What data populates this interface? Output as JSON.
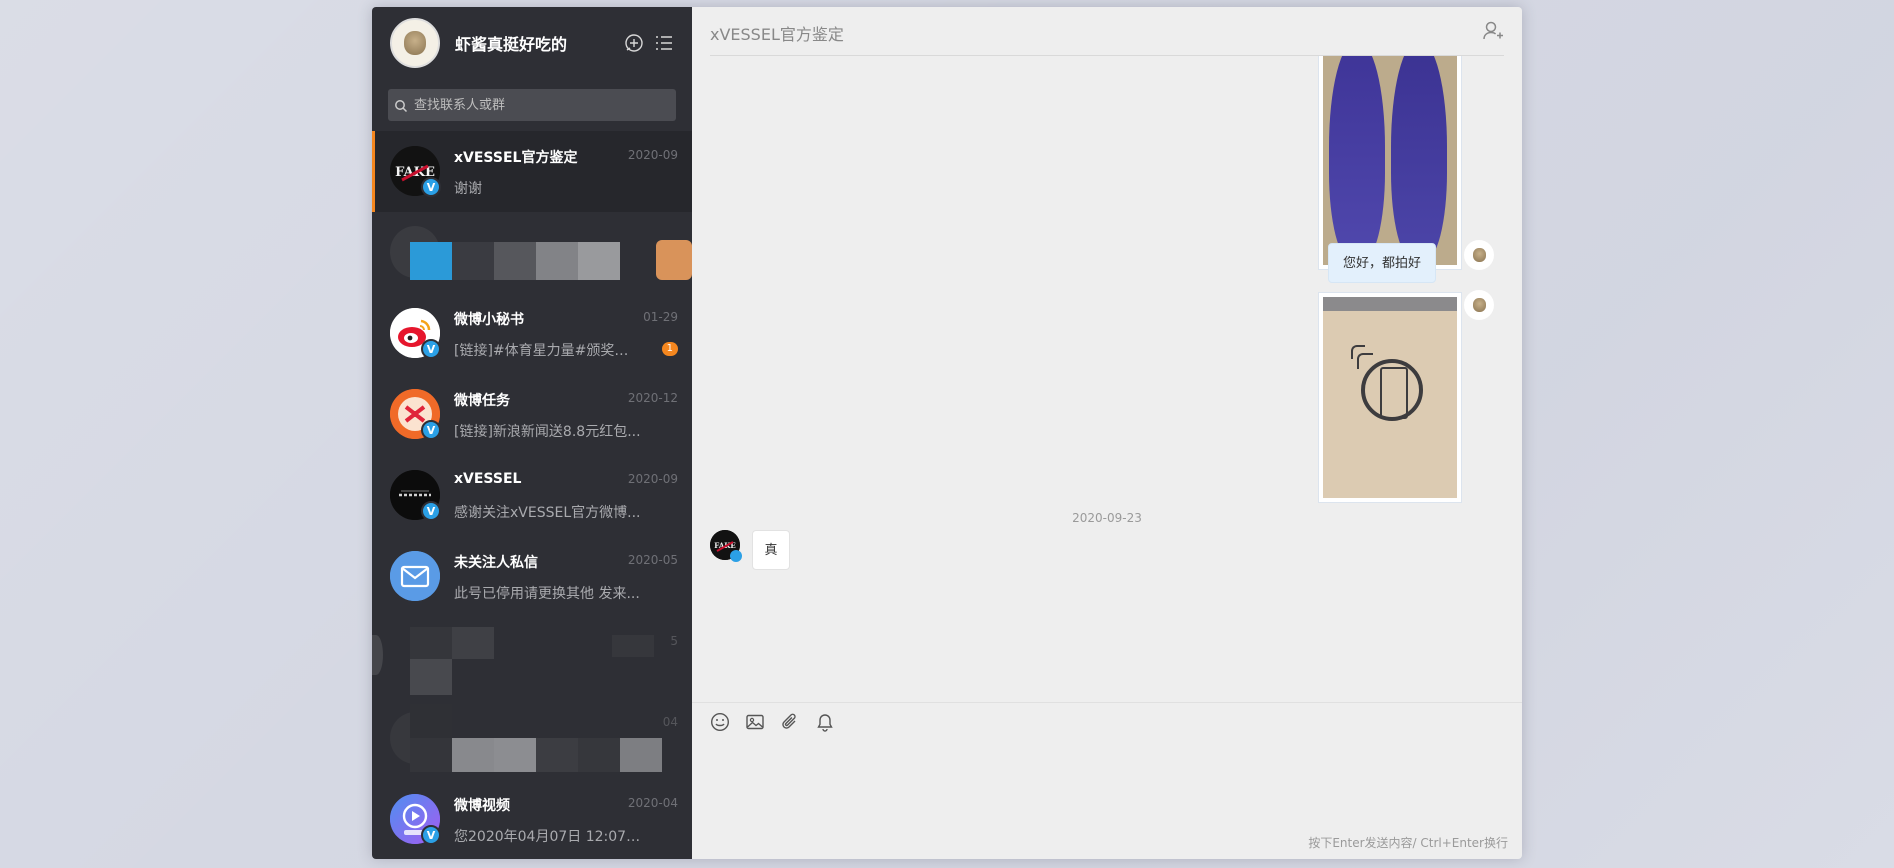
{
  "user": {
    "name": "虾酱真挺好吃的"
  },
  "search": {
    "placeholder": "查找联系人或群"
  },
  "conversations": [
    {
      "name": "xVESSEL官方鉴定",
      "date": "2020-09",
      "preview": "谢谢",
      "avatar": "fake-logo",
      "verified": true,
      "active": true
    },
    {
      "name": "微博小秘书",
      "date": "01-29",
      "preview": "[链接]#体育星力量#颁奖盛...",
      "avatar": "weibo-logo",
      "verified": true,
      "unread": "1"
    },
    {
      "name": "微博任务",
      "date": "2020-12",
      "preview": "[链接]新浪新闻送8.8元红包...",
      "avatar": "weibo-task-logo",
      "verified": true
    },
    {
      "name": "xVESSEL",
      "date": "2020-09",
      "preview": "感谢关注xVESSEL官方微博...",
      "avatar": "xvessel-logo",
      "verified": true
    },
    {
      "name": "未关注人私信",
      "date": "2020-05",
      "preview": "此号已停用请更换其他 发来...",
      "avatar": "mail-icon",
      "verified": false
    },
    {
      "name": "微博视频",
      "date": "2020-04",
      "preview": "您2020年04月07日 12:07上...",
      "avatar": "video-logo",
      "verified": true
    }
  ],
  "blurred_dates": [
    "5",
    "04"
  ],
  "chat": {
    "title": "xVESSEL官方鉴定",
    "messages": [
      {
        "type": "image",
        "side": "out",
        "content": "insole-photo"
      },
      {
        "type": "text",
        "side": "out",
        "text": "您好，都拍好了"
      },
      {
        "type": "image",
        "side": "out",
        "content": "box-stamp-photo"
      },
      {
        "type": "date",
        "text": "2020-09-23"
      },
      {
        "type": "text",
        "side": "in",
        "text": "真"
      }
    ]
  },
  "composer": {
    "tools": [
      "emoji-icon",
      "image-icon",
      "attachment-icon",
      "bell-icon"
    ],
    "hint": "按下Enter发送内容/ Ctrl+Enter换行"
  },
  "colors": {
    "accent": "#f5871f",
    "verified": "#2ba0e6",
    "sidebar": "#2e2f35",
    "chat_bg": "#eeeeee"
  }
}
